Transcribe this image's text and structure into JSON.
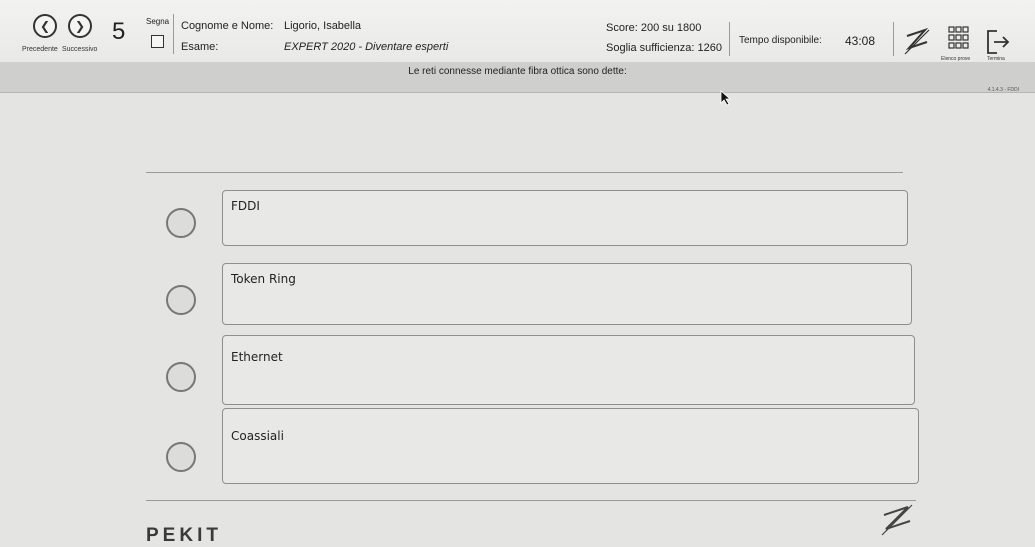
{
  "header": {
    "prev_label": "Precedente",
    "next_label": "Successivo",
    "question_number": "5",
    "mark_label": "Segna",
    "candidate_label": "Cognome e Nome:",
    "candidate_name": "Ligorio, Isabella",
    "exam_label": "Esame:",
    "exam_name": "EXPERT 2020 - Diventare esperti",
    "score_text": "Score: 200 su 1800",
    "threshold_text": "Soglia sufficienza: 1260",
    "time_label": "Tempo disponibile:",
    "time_value": "43:08",
    "list_label": "Elenco prove",
    "end_label": "Termina"
  },
  "question": {
    "text": "Le reti connesse mediante fibra ottica sono dette:",
    "code": "4.1.4.3 - FDDI"
  },
  "answers": [
    {
      "label": "FDDI"
    },
    {
      "label": "Token Ring"
    },
    {
      "label": "Ethernet"
    },
    {
      "label": "Coassiali"
    }
  ],
  "footer": {
    "brand": "PEKIT"
  },
  "icons": {
    "prev": "chevron-left-icon",
    "next": "chevron-right-icon",
    "calculator": "zigzag-icon",
    "list": "grid-icon",
    "end": "exit-icon"
  }
}
